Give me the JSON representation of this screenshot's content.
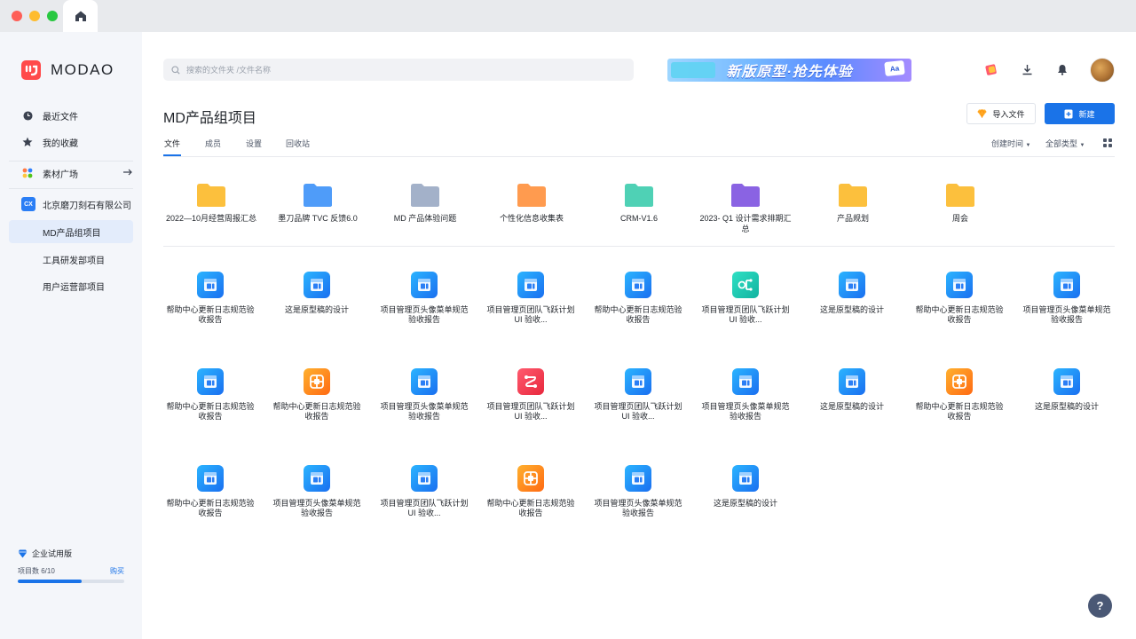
{
  "sidebar": {
    "logo_text": "MODAO",
    "recent": "最近文件",
    "favorites": "我的收藏",
    "assets": "素材广场",
    "company_badge": "CX",
    "company": "北京磨刀刻石有限公司",
    "projects": [
      "MD产品组项目",
      "工具研发部项目",
      "用户运营部项目"
    ],
    "trial_label": "企业试用版",
    "project_count": "项目数 6/10",
    "project_used": 6,
    "project_max": 10,
    "buy": "购买"
  },
  "search": {
    "placeholder": "搜索的文件夹 /文件名称"
  },
  "banner": {
    "text": "新版原型·抢先体验",
    "badge": "Aa"
  },
  "header": {
    "title": "MD产品组项目",
    "import_label": "导入文件",
    "new_label": "新建"
  },
  "tabs": [
    "文件",
    "成员",
    "设置",
    "回收站"
  ],
  "sort": {
    "created": "创建时间",
    "type": "全部类型"
  },
  "folders": [
    {
      "name": "2022—10月经营周报汇总",
      "color": "#fbbf3d"
    },
    {
      "name": "墨刀品牌 TVC 反馈6.0",
      "color": "#4f9cf9"
    },
    {
      "name": "MD 产品体验问题",
      "color": "#a3b1c9"
    },
    {
      "name": "个性化信息收集表",
      "color": "#ff9b4f"
    },
    {
      "name": "CRM-V1.6",
      "color": "#4fd1b5"
    },
    {
      "name": "2023- Q1 设计需求排期汇总",
      "color": "#8a63e3"
    },
    {
      "name": "产品规划",
      "color": "#fbbf3d"
    },
    {
      "name": "周会",
      "color": "#fbbf3d"
    }
  ],
  "files": [
    {
      "name": "帮助中心更新日志规范验收报告",
      "icon": "prototype-icon",
      "color": "blue"
    },
    {
      "name": "这是原型稿的设计",
      "icon": "prototype-icon",
      "color": "blue"
    },
    {
      "name": "项目管理页头像菜单规范验收报告",
      "icon": "prototype-icon",
      "color": "blue"
    },
    {
      "name": "项目管理页团队飞跃计划 UI 验收...",
      "icon": "prototype-icon",
      "color": "blue"
    },
    {
      "name": "帮助中心更新日志规范验收报告",
      "icon": "prototype-icon",
      "color": "blue"
    },
    {
      "name": "项目管理页团队飞跃计划 UI 验收...",
      "icon": "mindmap-icon",
      "color": "teal"
    },
    {
      "name": "这是原型稿的设计",
      "icon": "prototype-icon",
      "color": "blue"
    },
    {
      "name": "帮助中心更新日志规范验收报告",
      "icon": "prototype-icon",
      "color": "blue"
    },
    {
      "name": "项目管理页头像菜单规范验收报告",
      "icon": "prototype-icon",
      "color": "blue"
    },
    {
      "name": "帮助中心更新日志规范验收报告",
      "icon": "prototype-icon",
      "color": "blue"
    },
    {
      "name": "帮助中心更新日志规范验收报告",
      "icon": "design-icon",
      "color": "orange"
    },
    {
      "name": "项目管理页头像菜单规范验收报告",
      "icon": "prototype-icon",
      "color": "blue"
    },
    {
      "name": "项目管理页团队飞跃计划 UI 验收...",
      "icon": "flowchart-icon",
      "color": "red"
    },
    {
      "name": "项目管理页团队飞跃计划 UI 验收...",
      "icon": "prototype-icon",
      "color": "blue"
    },
    {
      "name": "项目管理页头像菜单规范验收报告",
      "icon": "prototype-icon",
      "color": "blue"
    },
    {
      "name": "这是原型稿的设计",
      "icon": "prototype-icon",
      "color": "blue"
    },
    {
      "name": "帮助中心更新日志规范验收报告",
      "icon": "design-icon",
      "color": "orange"
    },
    {
      "name": "这是原型稿的设计",
      "icon": "prototype-icon",
      "color": "blue"
    },
    {
      "name": "帮助中心更新日志规范验收报告",
      "icon": "prototype-icon",
      "color": "blue"
    },
    {
      "name": "项目管理页头像菜单规范验收报告",
      "icon": "prototype-icon",
      "color": "blue"
    },
    {
      "name": "项目管理页团队飞跃计划 UI 验收...",
      "icon": "prototype-icon",
      "color": "blue"
    },
    {
      "name": "帮助中心更新日志规范验收报告",
      "icon": "design-icon",
      "color": "orange"
    },
    {
      "name": "项目管理页头像菜单规范验收报告",
      "icon": "prototype-icon",
      "color": "blue"
    },
    {
      "name": "这是原型稿的设计",
      "icon": "prototype-icon",
      "color": "blue"
    }
  ],
  "help": "?"
}
